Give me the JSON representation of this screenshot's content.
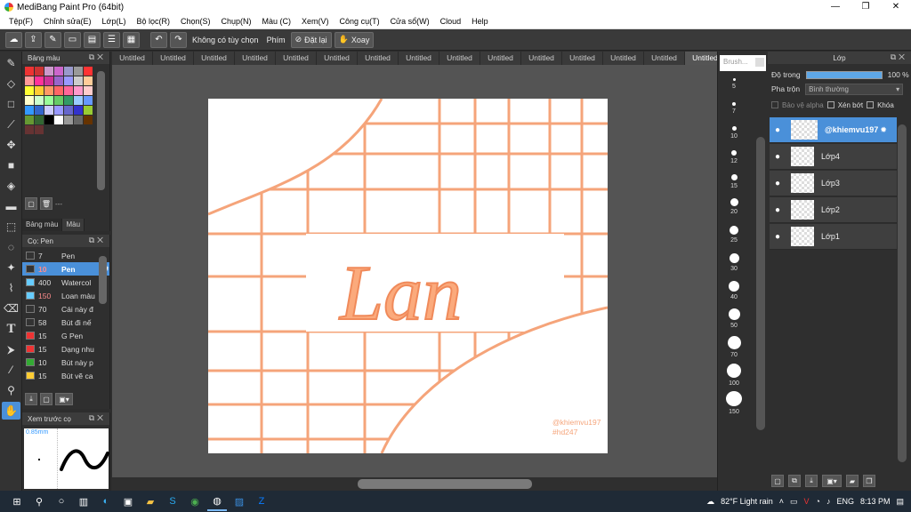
{
  "window": {
    "title": "MediBang Paint Pro (64bit)",
    "controls": [
      "—",
      "❐",
      "✕"
    ]
  },
  "menu": [
    "Tệp(F)",
    "Chỉnh sửa(E)",
    "Lớp(L)",
    "Bộ lọc(R)",
    "Chọn(S)",
    "Chụp(N)",
    "Màu (C)",
    "Xem(V)",
    "Công cụ(T)",
    "Cửa sổ(W)",
    "Cloud",
    "Help"
  ],
  "toolbar": {
    "no_option_label": "Không có tùy chọn",
    "key_label": "Phím",
    "reset_label": "Đặt lại",
    "pan_label": "Xoay"
  },
  "color_panel": {
    "title": "Bảng màu",
    "tabs": [
      "Bảng màu",
      "Màu"
    ],
    "ellipsis": "---",
    "swatches": [
      "#e33",
      "#c33",
      "#c9c",
      "#c6c",
      "#99c",
      "#999",
      "#f33",
      "#f99",
      "#f39",
      "#c39",
      "#96c",
      "#99f",
      "#ccc",
      "#fc9",
      "#ff3",
      "#fc3",
      "#f96",
      "#f66",
      "#f69",
      "#f9c",
      "#fcc",
      "#ffc",
      "#cfc",
      "#9f9",
      "#6c6",
      "#396",
      "#9cf",
      "#69f",
      "#39f",
      "#36c",
      "#ccf",
      "#99f",
      "#66c",
      "#33c",
      "#9c3",
      "#693",
      "#363",
      "#000",
      "#fff",
      "#999",
      "#666",
      "#630",
      "#633",
      "#633"
    ]
  },
  "brush_panel": {
    "title": "Cọ: Pen",
    "brushes": [
      {
        "size": "7",
        "name": "Pen",
        "color": "#333"
      },
      {
        "size": "10",
        "name": "Pen",
        "color": "#333"
      },
      {
        "size": "400",
        "name": "Watercol",
        "color": "#6cf"
      },
      {
        "size": "150",
        "name": "Loan màu",
        "color": "#6cf"
      },
      {
        "size": "70",
        "name": "Cái này đ",
        "color": "#333"
      },
      {
        "size": "58",
        "name": "Bút đi nế",
        "color": "#333"
      },
      {
        "size": "15",
        "name": "G Pen",
        "color": "#e33"
      },
      {
        "size": "15",
        "name": "Dạng nhu",
        "color": "#e33"
      },
      {
        "size": "10",
        "name": "Bút này p",
        "color": "#3a3"
      },
      {
        "size": "15",
        "name": "Bút vẽ ca",
        "color": "#fc3"
      }
    ]
  },
  "preview_panel": {
    "title": "Xem trước cọ",
    "size_text": "0.85mm"
  },
  "documents": [
    "Untitled",
    "Untitled",
    "Untitled",
    "Untitled",
    "Untitled",
    "Untitled",
    "Untitled",
    "Untitled",
    "Untitled",
    "Untitled",
    "Untitled",
    "Untitled",
    "Untitled",
    "Untitled",
    "Untitled"
  ],
  "canvas": {
    "lettering": "Lan",
    "watermark_line1": "@khiemvu197",
    "watermark_line2": "#hd247",
    "grid_color": "#f5a47a",
    "lettering_color": "#fbaa7c"
  },
  "brush_size_panel": {
    "title": "Brush...",
    "sizes": [
      "5",
      "7",
      "10",
      "12",
      "15",
      "20",
      "25",
      "30",
      "40",
      "50",
      "70",
      "100",
      "150"
    ]
  },
  "layer_panel": {
    "title": "Lớp",
    "opacity_label": "Độ trong",
    "opacity_value": "100 %",
    "opacity_percent": 100,
    "blend_label": "Pha trộn",
    "blend_value": "Bình thường",
    "protect_alpha": "Bảo vệ alpha",
    "clipping": "Xén bớt",
    "lock": "Khóa",
    "layers": [
      {
        "name": "@khiemvu197",
        "active": true
      },
      {
        "name": "Lớp4",
        "active": false
      },
      {
        "name": "Lớp3",
        "active": false
      },
      {
        "name": "Lớp2",
        "active": false
      },
      {
        "name": "Lớp1",
        "active": false
      }
    ]
  },
  "taskbar": {
    "weather": "82°F  Light rain",
    "language": "ENG",
    "time": "8:13 PM"
  }
}
